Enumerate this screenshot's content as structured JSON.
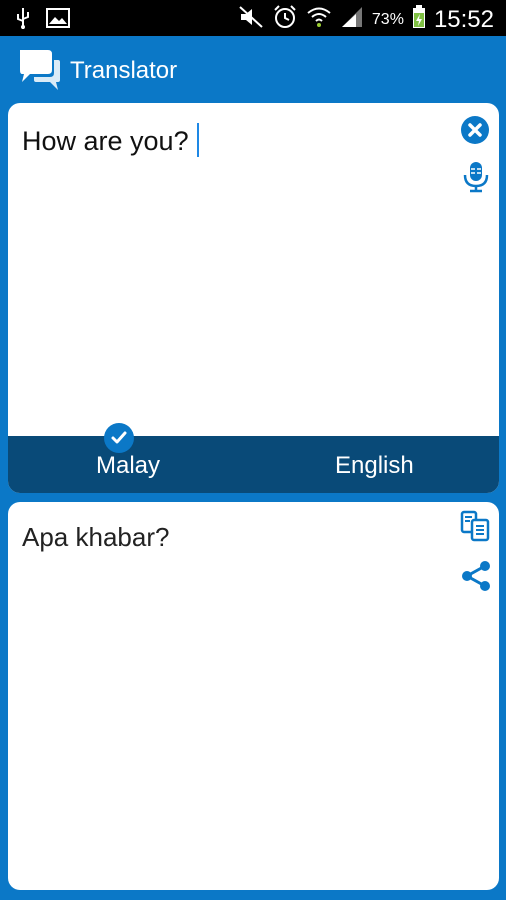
{
  "status_bar": {
    "battery_percent": "73%",
    "time": "15:52",
    "icons": [
      "usb-icon",
      "image-icon",
      "mute-icon",
      "alarm-icon",
      "wifi-icon",
      "signal-icon",
      "battery-icon"
    ]
  },
  "app_bar": {
    "title": "Translator",
    "icon": "chat-bubbles-icon"
  },
  "input_panel": {
    "text": "How are you?",
    "icons": [
      "clear-icon",
      "microphone-icon"
    ]
  },
  "language_bar": {
    "source_language": "Malay",
    "target_language": "English",
    "selected": "Malay"
  },
  "output_panel": {
    "text": "Apa khabar?",
    "icons": [
      "copy-icon",
      "share-icon"
    ]
  },
  "colors": {
    "primary": "#0b78c7",
    "language_bar": "#094a78",
    "status_bar": "#000000",
    "card": "#ffffff"
  }
}
